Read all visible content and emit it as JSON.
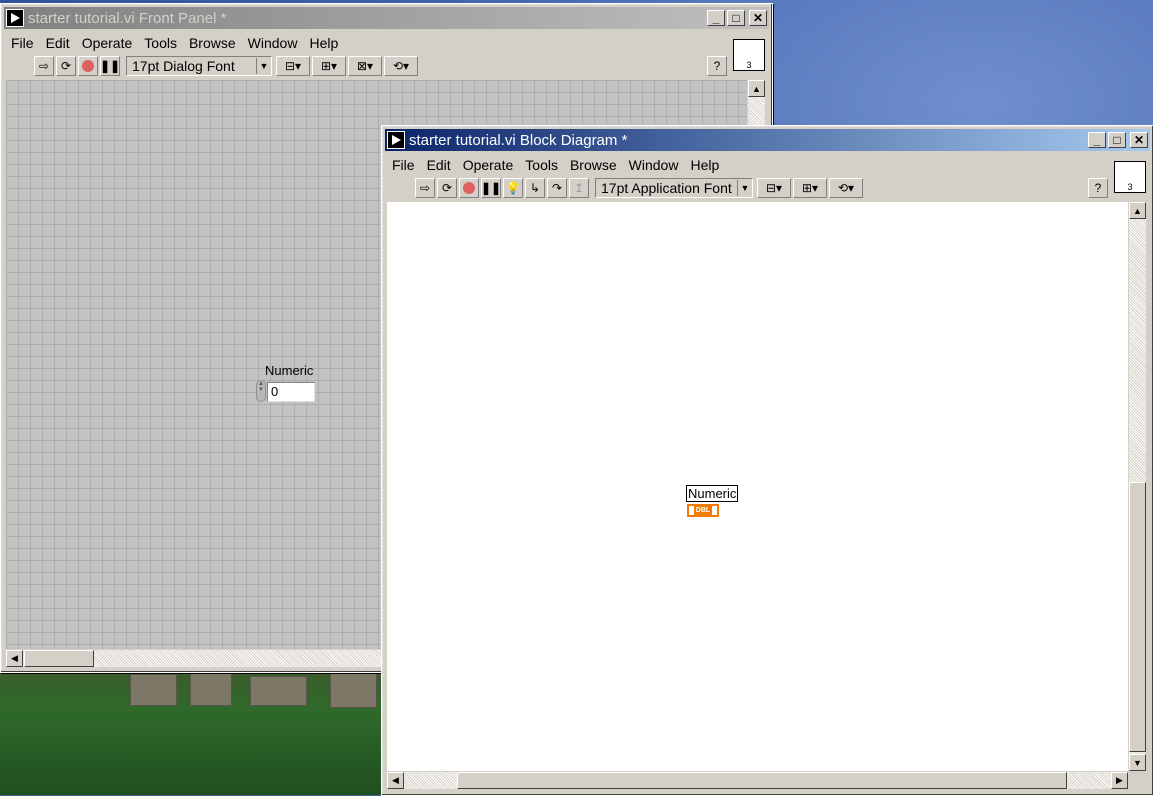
{
  "front_panel": {
    "title": "starter tutorial.vi Front Panel *",
    "menu": [
      "File",
      "Edit",
      "Operate",
      "Tools",
      "Browse",
      "Window",
      "Help"
    ],
    "font_select": "17pt Dialog Font",
    "connector_pane_number": "3",
    "numeric_control": {
      "label": "Numeric",
      "value": "0"
    }
  },
  "block_diagram": {
    "title": "starter tutorial.vi Block Diagram *",
    "menu": [
      "File",
      "Edit",
      "Operate",
      "Tools",
      "Browse",
      "Window",
      "Help"
    ],
    "font_select": "17pt Application Font",
    "connector_pane_number": "3",
    "terminal": {
      "label": "Numeric",
      "type": "DBL"
    }
  },
  "colors": {
    "active_title": "#0a246a",
    "terminal": "#f47a00"
  }
}
